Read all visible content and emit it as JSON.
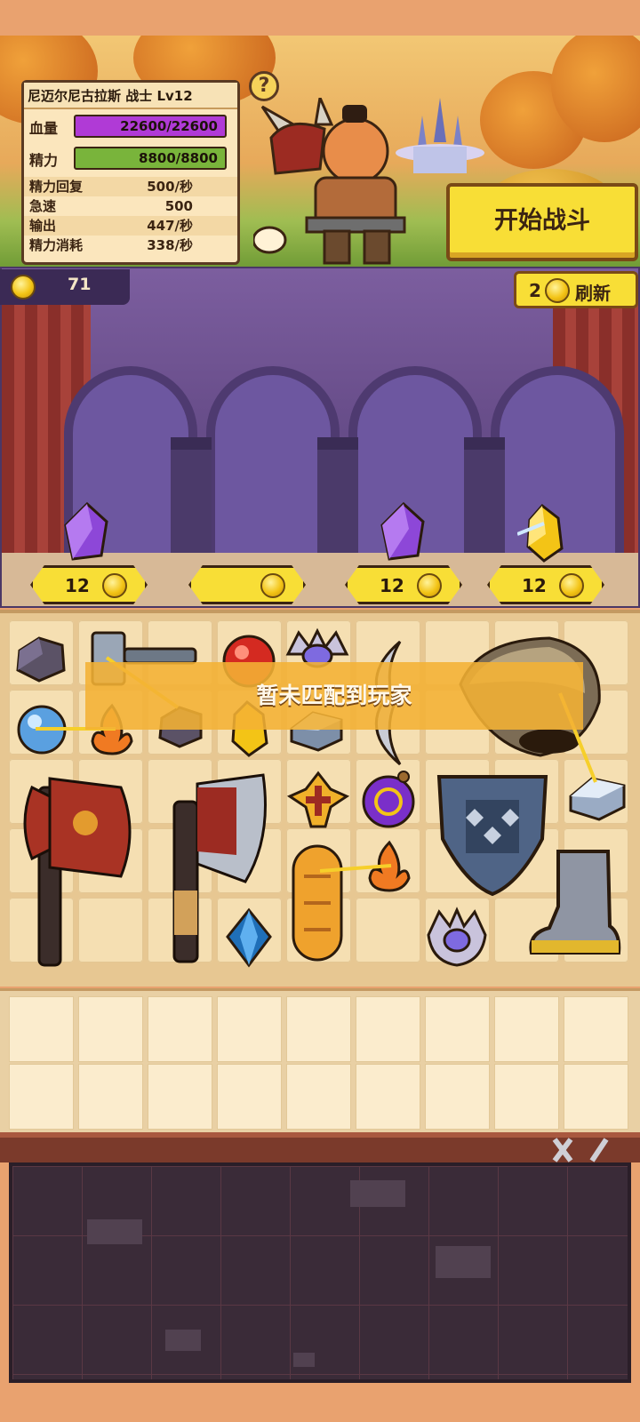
{
  "hero": {
    "name_line": "尼迈尔尼古拉斯 战士 Lv12",
    "hp_label": "血量",
    "hp_value": "22600/22600",
    "hp_fraction": 1.0,
    "energy_label": "精力",
    "energy_value": "8800/8800",
    "energy_fraction": 1.0,
    "stats": [
      {
        "key": "精力回复",
        "value": "500/秒"
      },
      {
        "key": "急速",
        "value": "500"
      },
      {
        "key": "输出",
        "value": "447/秒"
      },
      {
        "key": "精力消耗",
        "value": "338/秒"
      }
    ],
    "help_symbol": "?"
  },
  "start_button": {
    "label": "开始战斗"
  },
  "shop": {
    "gold": "71",
    "refresh_cost": "2",
    "refresh_label": "刷新",
    "items": [
      {
        "icon": "purple-crystal-icon",
        "price": "12"
      },
      {
        "icon": "empty-slot",
        "price": ""
      },
      {
        "icon": "purple-crystal-icon",
        "price": "12"
      },
      {
        "icon": "gold-crystal-icon",
        "price": "12"
      }
    ]
  },
  "status": {
    "no_match": "暂未匹配到玩家"
  },
  "colors": {
    "hp_bar": "#b03ad6",
    "energy_bar": "#79b43b",
    "button_yellow": "#f8de36",
    "panel_border": "#5a3a22"
  }
}
